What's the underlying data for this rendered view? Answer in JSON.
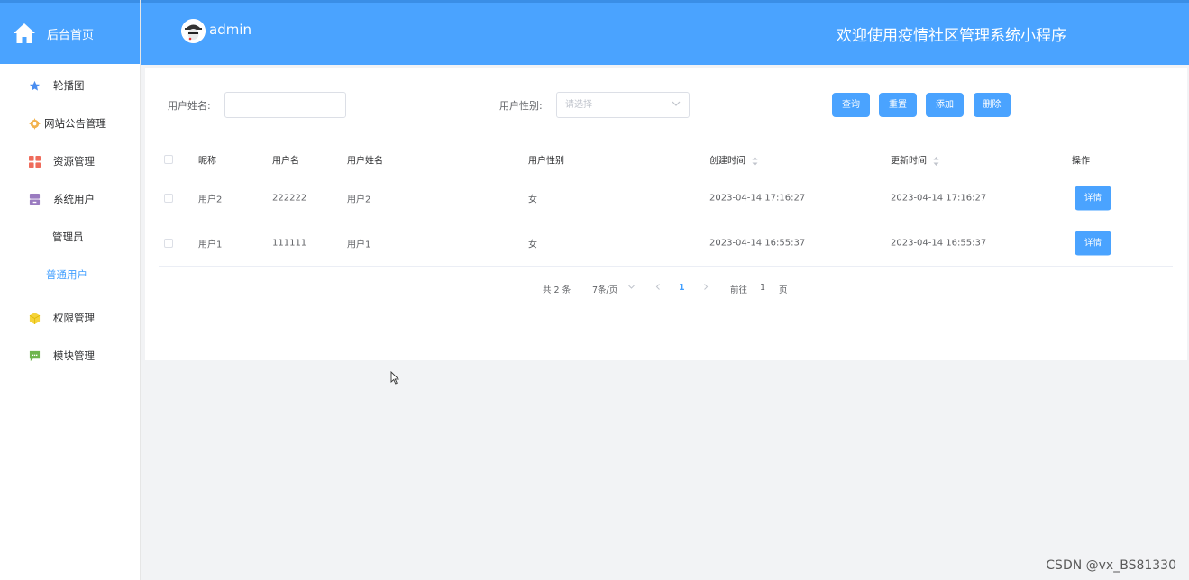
{
  "sidebar": {
    "title": "后台首页",
    "items": [
      {
        "label": "轮播图",
        "icon": "star-icon"
      },
      {
        "label": "网站公告管理",
        "icon": "gear-icon"
      },
      {
        "label": "资源管理",
        "icon": "grid-icon"
      },
      {
        "label": "系统用户",
        "icon": "storage-icon"
      },
      {
        "label": "管理员"
      },
      {
        "label": "普通用户"
      },
      {
        "label": "权限管理",
        "icon": "cube-icon"
      },
      {
        "label": "模块管理",
        "icon": "chat-icon"
      }
    ]
  },
  "header": {
    "username": "admin",
    "welcome": "欢迎使用疫情社区管理系统小程序"
  },
  "search": {
    "name_label": "用户姓名:",
    "gender_label": "用户性别:",
    "gender_placeholder": "请选择",
    "buttons": {
      "query": "查询",
      "reset": "重置",
      "add": "添加",
      "delete": "删除"
    }
  },
  "table": {
    "columns": [
      "昵称",
      "用户名",
      "用户姓名",
      "用户性别",
      "创建时间",
      "更新时间",
      "操作"
    ],
    "rows": [
      {
        "nickname": "用户2",
        "username": "222222",
        "realname": "用户2",
        "gender": "女",
        "created": "2023-04-14 17:16:27",
        "updated": "2023-04-14 17:16:27",
        "action": "详情"
      },
      {
        "nickname": "用户1",
        "username": "111111",
        "realname": "用户1",
        "gender": "女",
        "created": "2023-04-14 16:55:37",
        "updated": "2023-04-14 16:55:37",
        "action": "详情"
      }
    ]
  },
  "pagination": {
    "total": "共 2 条",
    "page_size": "7条/页",
    "current": "1",
    "goto_label": "前往",
    "goto_value": "1",
    "page_unit": "页"
  },
  "watermark": "CSDN @vx_BS81330",
  "colors": {
    "primary": "#4aa3ff",
    "active_text": "#409eff"
  }
}
